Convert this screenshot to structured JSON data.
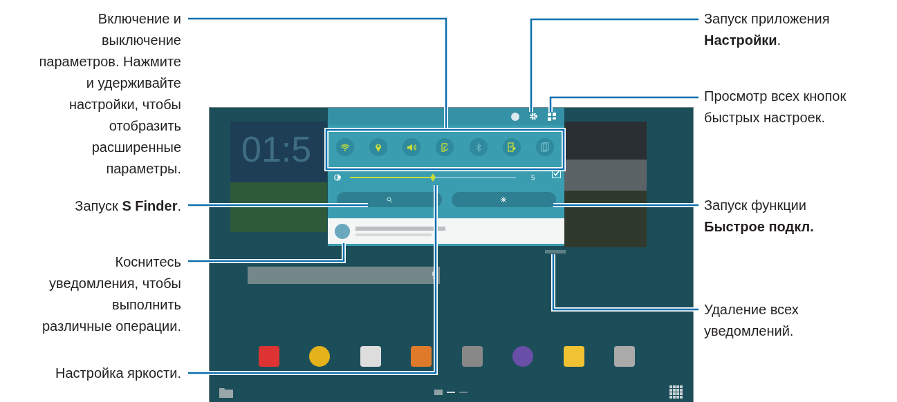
{
  "left_callouts": [
    {
      "text": "Включение и выключение параметров. Нажмите и удерживайте настройки, чтобы отобразить расширенные параметры."
    },
    {
      "text": "Запуск **S Finder**."
    },
    {
      "text": "Коснитесь уведомления, чтобы выполнить различные операции."
    },
    {
      "text": "Настройка яркости."
    }
  ],
  "right_callouts": [
    {
      "text": "Запуск приложения **Настройки**."
    },
    {
      "text": "Просмотр всех кнопок быстрых настроек."
    },
    {
      "text": "Запуск функции **Быстрое подкл.**"
    },
    {
      "text": "Удаление всех уведомлений."
    }
  ],
  "screen": {
    "clock": "01:5",
    "quick_toggles": [
      {
        "kind": "wifi",
        "on": true
      },
      {
        "kind": "location",
        "on": true
      },
      {
        "kind": "sound",
        "on": true
      },
      {
        "kind": "rotation",
        "on": true
      },
      {
        "kind": "bluetooth",
        "on": false
      },
      {
        "kind": "smart_stay",
        "on": true
      },
      {
        "kind": "power_saving",
        "on": false
      }
    ],
    "brightness": {
      "level": 0.5,
      "reading": "5",
      "auto": true
    }
  }
}
